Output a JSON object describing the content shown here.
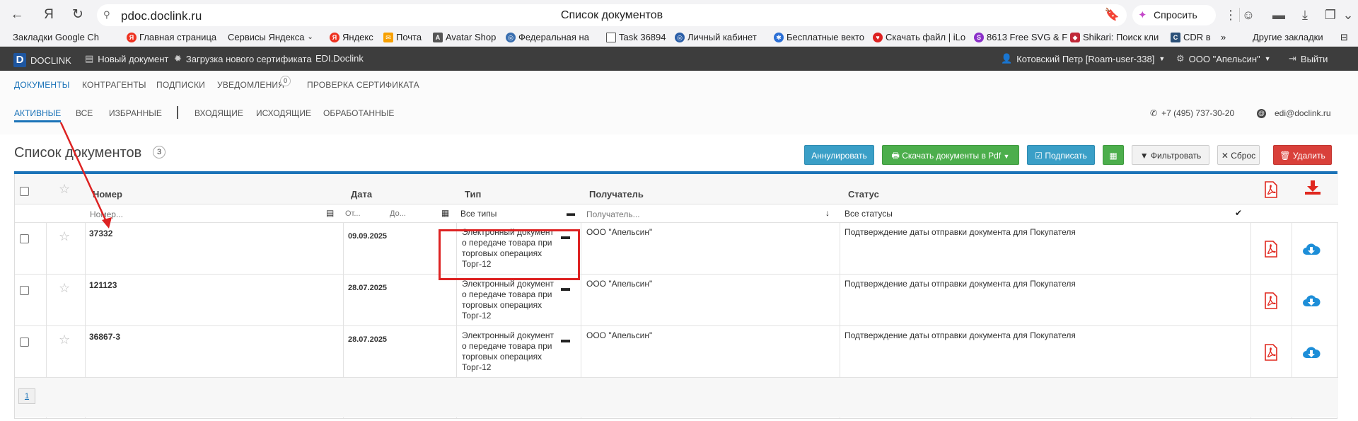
{
  "browser": {
    "url": "pdoc.doclink.ru",
    "page_title": "Список документов",
    "ask_label": "Спросить",
    "bookmarks": [
      {
        "label": "Закладки Google Ch",
        "icon": "none"
      },
      {
        "label": "Главная страница",
        "icon": "yandex-icon"
      },
      {
        "label": "Сервисы Яндекса",
        "icon": "none"
      },
      {
        "label": "Яндекс",
        "icon": "yandex-icon"
      },
      {
        "label": "Почта",
        "icon": "mail-icon"
      },
      {
        "label": "Avatar Shop",
        "icon": "avatar-icon"
      },
      {
        "label": "Федеральная на",
        "icon": "globe-icon"
      },
      {
        "label": "Task 36894",
        "icon": "page-icon"
      },
      {
        "label": "Личный кабинет",
        "icon": "globe-icon"
      },
      {
        "label": "Бесплатные векто",
        "icon": "bug-icon"
      },
      {
        "label": "Скачать файл | iLo",
        "icon": "heart-icon"
      },
      {
        "label": "8613 Free SVG & F",
        "icon": "svg-icon"
      },
      {
        "label": "Shikari: Поиск кли",
        "icon": "shield-icon"
      },
      {
        "label": "CDR в",
        "icon": "cdr-icon"
      }
    ],
    "other_bookmarks": "Другие закладки"
  },
  "app": {
    "logo_text": "DOCLINK",
    "new_doc": "Новый документ",
    "upload_cert": "Загрузка нового сертификата",
    "edi": "EDI.Doclink",
    "user": "Котовский Петр [Roam-user-338]",
    "org": "ООО \"Апельсин\"",
    "logout": "Выйти"
  },
  "nav": {
    "main_tabs": [
      "ДОКУМЕНТЫ",
      "КОНТРАГЕНТЫ",
      "ПОДПИСКИ",
      "УВЕДОМЛЕНИЯ",
      "ПРОВЕРКА СЕРТИФИКАТА"
    ],
    "notif_count": "0",
    "sub_tabs": [
      "АКТИВНЫЕ",
      "ВСЕ",
      "ИЗБРАННЫЕ",
      "ВХОДЯЩИЕ",
      "ИСХОДЯЩИЕ",
      "ОБРАБОТАННЫЕ"
    ],
    "phone": "+7 (495) 737-30-20",
    "email": "edi@doclink.ru"
  },
  "list": {
    "title": "Список документов",
    "count": "3",
    "buttons": {
      "annul": "Аннулировать",
      "download_pdf": "Скачать документы в Pdf",
      "sign": "Подписать",
      "filter": "Фильтровать",
      "reset": "Сброс",
      "delete": "Удалить"
    },
    "columns": [
      "Номер",
      "Дата",
      "Тип",
      "Получатель",
      "Статус"
    ],
    "filters": {
      "number_placeholder": "Номер...",
      "date_from": "От...",
      "date_to": "До...",
      "type_value": "Все типы",
      "recipient_placeholder": "Получатель...",
      "status_value": "Все статусы"
    },
    "rows": [
      {
        "number": "37332",
        "date": "09.09.2025",
        "type": "Электронный документ о передаче товара при торговых операциях Торг-12",
        "recipient": "ООО \"Апельсин\"",
        "status": "Подтверждение даты отправки документа для Покупателя"
      },
      {
        "number": "121123",
        "date": "28.07.2025",
        "type": "Электронный документ о передаче товара при торговых операциях Торг-12",
        "recipient": "ООО \"Апельсин\"",
        "status": "Подтверждение даты отправки документа для Покупателя"
      },
      {
        "number": "36867-3",
        "date": "28.07.2025",
        "type": "Электронный документ о передаче товара при торговых операциях Торг-12",
        "recipient": "ООО \"Апельсин\"",
        "status": "Подтверждение даты отправки документа для Покупателя"
      }
    ],
    "page": "1"
  },
  "colors": {
    "accent": "#1b73b8",
    "annotation": "#dd2222",
    "pdf": "#e0281f",
    "download": "#1d8ed8"
  }
}
